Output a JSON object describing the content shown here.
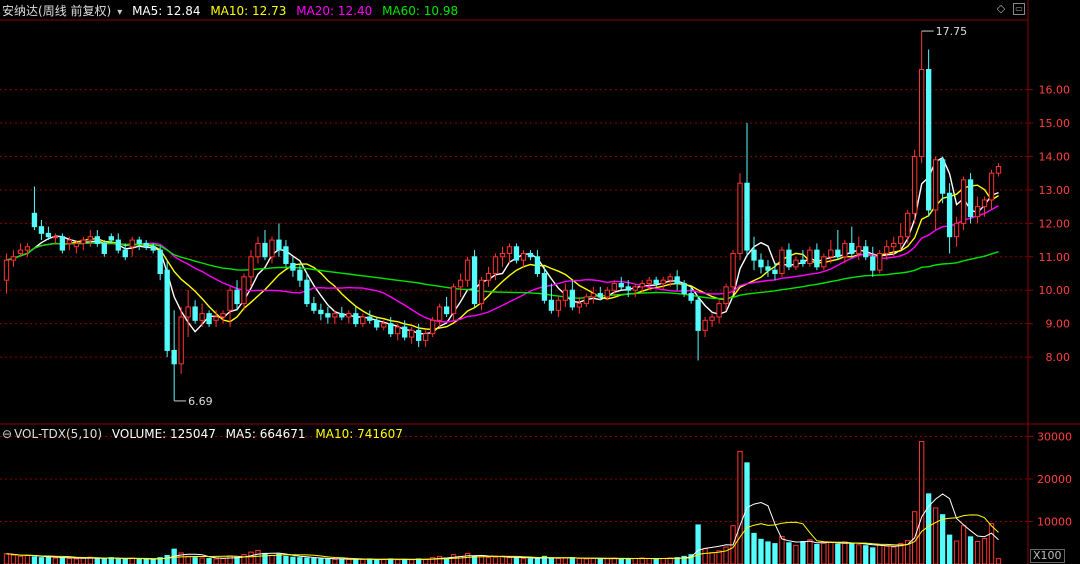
{
  "price_panel": {
    "stock_name": "安纳达",
    "period": "(周线 前复权)",
    "ma5_label": "MA5: 12.84",
    "ma10_label": "MA10: 12.73",
    "ma20_label": "MA20: 12.40",
    "ma60_label": "MA60: 10.98",
    "high_label": "17.75",
    "low_label": "6.69"
  },
  "volume_panel": {
    "indicator_label": "VOL-TDX(5,10)",
    "volume_label": "VOLUME: 125047",
    "ma5_label": "MA5: 664671",
    "ma10_label": "MA10: 741607",
    "unit_label": "X100"
  },
  "colors": {
    "up": "#ff3232",
    "down": "#54fcfc",
    "ma5": "#ffffff",
    "ma10": "#ffff00",
    "ma20": "#ff00ff",
    "ma60": "#00e600",
    "grid": "#8b0000",
    "axis_text": "#ff4040"
  },
  "chart_data": [
    {
      "type": "candlestick",
      "title": "安纳达(周线 前复权)",
      "y_ticks": [
        "8.00",
        "9.00",
        "10.00",
        "11.00",
        "12.00",
        "13.00",
        "14.00",
        "15.00",
        "16.00"
      ],
      "ylim": [
        6.0,
        18.2
      ],
      "grid": true,
      "annotations": [
        {
          "text": "17.75",
          "value": 17.75
        },
        {
          "text": "6.69",
          "value": 6.69
        }
      ],
      "ohlc": [
        [
          10.3,
          11.1,
          9.9,
          10.9
        ],
        [
          10.9,
          11.2,
          10.7,
          11.0
        ],
        [
          11.1,
          11.4,
          11.0,
          11.2
        ],
        [
          11.2,
          11.4,
          11.0,
          11.3
        ],
        [
          12.3,
          13.1,
          11.8,
          11.9
        ],
        [
          11.9,
          12.1,
          11.5,
          11.7
        ],
        [
          11.7,
          11.9,
          11.5,
          11.6
        ],
        [
          11.6,
          11.7,
          11.4,
          11.6
        ],
        [
          11.6,
          11.7,
          11.1,
          11.2
        ],
        [
          11.4,
          11.6,
          11.2,
          11.5
        ],
        [
          11.3,
          11.5,
          11.1,
          11.4
        ],
        [
          11.4,
          11.6,
          11.2,
          11.5
        ],
        [
          11.5,
          11.8,
          11.3,
          11.6
        ],
        [
          11.6,
          11.8,
          11.3,
          11.4
        ],
        [
          11.4,
          11.5,
          11.0,
          11.1
        ],
        [
          11.6,
          11.7,
          11.4,
          11.5
        ],
        [
          11.5,
          11.7,
          11.1,
          11.2
        ],
        [
          11.2,
          11.4,
          10.9,
          11.0
        ],
        [
          11.3,
          11.6,
          11.0,
          11.5
        ],
        [
          11.5,
          11.6,
          11.2,
          11.4
        ],
        [
          11.4,
          11.5,
          11.2,
          11.3
        ],
        [
          11.3,
          11.4,
          11.1,
          11.2
        ],
        [
          11.2,
          11.3,
          10.3,
          10.5
        ],
        [
          10.6,
          10.9,
          8.0,
          8.2
        ],
        [
          8.2,
          9.4,
          6.69,
          7.8
        ],
        [
          7.8,
          9.5,
          7.5,
          9.2
        ],
        [
          9.2,
          10.0,
          8.6,
          9.5
        ],
        [
          9.5,
          9.7,
          9.0,
          9.1
        ],
        [
          9.1,
          9.6,
          8.9,
          9.3
        ],
        [
          9.3,
          9.4,
          8.9,
          9.0
        ],
        [
          9.1,
          9.4,
          8.9,
          9.2
        ],
        [
          9.2,
          9.4,
          9.0,
          9.3
        ],
        [
          9.4,
          10.1,
          8.9,
          10.0
        ],
        [
          10.0,
          10.3,
          9.4,
          9.6
        ],
        [
          9.6,
          10.5,
          9.4,
          10.4
        ],
        [
          10.4,
          11.2,
          10.1,
          11.0
        ],
        [
          11.0,
          11.6,
          10.8,
          11.4
        ],
        [
          11.4,
          11.8,
          10.9,
          11.0
        ],
        [
          11.0,
          11.6,
          10.8,
          11.5
        ],
        [
          11.5,
          12.0,
          11.0,
          11.2
        ],
        [
          11.3,
          11.5,
          10.7,
          10.8
        ],
        [
          10.8,
          11.0,
          10.4,
          10.6
        ],
        [
          10.6,
          10.8,
          10.1,
          10.3
        ],
        [
          10.3,
          10.5,
          9.5,
          9.6
        ],
        [
          9.6,
          9.8,
          9.3,
          9.4
        ],
        [
          9.4,
          9.6,
          9.1,
          9.3
        ],
        [
          9.3,
          9.5,
          9.0,
          9.2
        ],
        [
          9.2,
          9.4,
          9.0,
          9.3
        ],
        [
          9.3,
          9.5,
          9.1,
          9.2
        ],
        [
          9.2,
          9.4,
          9.0,
          9.3
        ],
        [
          9.3,
          9.5,
          8.9,
          9.0
        ],
        [
          9.0,
          9.3,
          8.9,
          9.2
        ],
        [
          9.2,
          9.4,
          9.0,
          9.1
        ],
        [
          9.1,
          9.2,
          8.8,
          8.9
        ],
        [
          8.9,
          9.1,
          8.8,
          9.0
        ],
        [
          9.0,
          9.2,
          8.6,
          8.7
        ],
        [
          8.7,
          9.0,
          8.5,
          8.9
        ],
        [
          8.9,
          9.1,
          8.5,
          8.6
        ],
        [
          8.6,
          8.9,
          8.4,
          8.8
        ],
        [
          8.8,
          9.0,
          8.3,
          8.5
        ],
        [
          8.5,
          8.8,
          8.3,
          8.7
        ],
        [
          8.7,
          9.2,
          8.6,
          9.1
        ],
        [
          9.1,
          9.6,
          8.9,
          9.5
        ],
        [
          9.5,
          9.8,
          9.2,
          9.3
        ],
        [
          9.3,
          10.2,
          9.1,
          10.1
        ],
        [
          10.1,
          10.5,
          9.8,
          10.3
        ],
        [
          10.3,
          11.0,
          10.1,
          10.9
        ],
        [
          11.0,
          11.2,
          9.5,
          9.6
        ],
        [
          9.6,
          10.4,
          9.4,
          10.3
        ],
        [
          10.3,
          10.7,
          10.1,
          10.5
        ],
        [
          10.5,
          11.1,
          10.3,
          11.0
        ],
        [
          11.0,
          11.3,
          10.7,
          11.1
        ],
        [
          11.1,
          11.4,
          10.8,
          11.3
        ],
        [
          11.3,
          11.4,
          10.8,
          10.9
        ],
        [
          10.9,
          11.2,
          10.7,
          11.1
        ],
        [
          11.1,
          11.2,
          10.9,
          11.0
        ],
        [
          11.0,
          11.2,
          10.4,
          10.5
        ],
        [
          10.5,
          10.7,
          9.6,
          9.7
        ],
        [
          9.7,
          10.2,
          9.3,
          9.4
        ],
        [
          9.4,
          9.8,
          9.2,
          9.7
        ],
        [
          9.7,
          10.2,
          9.5,
          10.0
        ],
        [
          10.0,
          10.3,
          9.4,
          9.5
        ],
        [
          9.5,
          9.8,
          9.3,
          9.6
        ],
        [
          9.6,
          9.9,
          9.5,
          9.8
        ],
        [
          9.8,
          10.1,
          9.6,
          9.9
        ],
        [
          9.9,
          10.1,
          9.7,
          9.8
        ],
        [
          9.8,
          10.1,
          9.7,
          10.0
        ],
        [
          10.0,
          10.3,
          9.8,
          10.2
        ],
        [
          10.2,
          10.4,
          10.0,
          10.1
        ],
        [
          10.1,
          10.3,
          9.8,
          10.0
        ],
        [
          10.0,
          10.2,
          9.8,
          10.1
        ],
        [
          10.1,
          10.3,
          9.9,
          10.2
        ],
        [
          10.2,
          10.4,
          10.0,
          10.3
        ],
        [
          10.3,
          10.4,
          10.1,
          10.2
        ],
        [
          10.2,
          10.4,
          10.0,
          10.3
        ],
        [
          10.3,
          10.5,
          10.1,
          10.4
        ],
        [
          10.4,
          10.6,
          10.0,
          10.2
        ],
        [
          10.2,
          10.3,
          9.8,
          9.9
        ],
        [
          9.9,
          10.1,
          9.6,
          9.7
        ],
        [
          9.7,
          9.8,
          7.9,
          8.8
        ],
        [
          8.8,
          9.2,
          8.6,
          9.1
        ],
        [
          9.1,
          9.3,
          8.9,
          9.2
        ],
        [
          9.2,
          9.7,
          9.0,
          9.6
        ],
        [
          9.6,
          10.2,
          9.4,
          10.1
        ],
        [
          10.1,
          11.2,
          9.9,
          11.1
        ],
        [
          11.1,
          13.5,
          10.9,
          13.2
        ],
        [
          13.2,
          15.0,
          11.0,
          11.2
        ],
        [
          11.2,
          11.6,
          10.6,
          10.9
        ],
        [
          10.9,
          11.1,
          10.5,
          10.7
        ],
        [
          10.7,
          10.9,
          10.4,
          10.6
        ],
        [
          10.6,
          10.8,
          10.3,
          10.5
        ],
        [
          10.5,
          11.3,
          10.4,
          11.2
        ],
        [
          11.2,
          11.4,
          10.6,
          10.7
        ],
        [
          10.7,
          11.0,
          10.6,
          10.9
        ],
        [
          10.9,
          11.2,
          10.7,
          10.8
        ],
        [
          10.8,
          11.3,
          10.7,
          11.2
        ],
        [
          11.2,
          11.4,
          10.6,
          10.7
        ],
        [
          10.7,
          11.1,
          10.6,
          11.0
        ],
        [
          11.0,
          11.5,
          10.8,
          11.2
        ],
        [
          11.2,
          11.8,
          10.9,
          11.0
        ],
        [
          11.0,
          11.5,
          10.8,
          11.4
        ],
        [
          11.4,
          11.9,
          11.0,
          11.1
        ],
        [
          11.1,
          11.6,
          10.9,
          11.3
        ],
        [
          11.3,
          11.5,
          10.9,
          11.0
        ],
        [
          11.0,
          11.3,
          10.4,
          10.6
        ],
        [
          10.6,
          11.2,
          10.5,
          11.1
        ],
        [
          11.1,
          11.5,
          10.9,
          11.3
        ],
        [
          11.3,
          11.6,
          11.0,
          11.4
        ],
        [
          11.4,
          12.0,
          11.2,
          11.6
        ],
        [
          11.6,
          12.4,
          11.4,
          12.3
        ],
        [
          12.3,
          14.2,
          12.0,
          14.0
        ],
        [
          14.0,
          17.75,
          13.8,
          16.6
        ],
        [
          16.6,
          17.2,
          12.2,
          12.4
        ],
        [
          12.4,
          14.0,
          11.8,
          13.9
        ],
        [
          13.9,
          14.0,
          12.6,
          12.9
        ],
        [
          12.9,
          13.2,
          11.1,
          11.6
        ],
        [
          11.6,
          12.2,
          11.3,
          12.0
        ],
        [
          12.0,
          13.4,
          11.8,
          13.3
        ],
        [
          13.3,
          13.5,
          12.0,
          12.2
        ],
        [
          12.2,
          12.8,
          12.0,
          12.5
        ],
        [
          12.5,
          12.8,
          12.2,
          12.7
        ],
        [
          12.7,
          13.6,
          12.4,
          13.5
        ],
        [
          13.5,
          13.8,
          13.4,
          13.7
        ]
      ]
    },
    {
      "type": "bar",
      "title": "VOL-TDX(5,10)",
      "y_ticks": [
        "10000",
        "20000",
        "30000"
      ],
      "ylim": [
        0,
        32000
      ],
      "unit": "X100",
      "values": [
        2400,
        2100,
        1800,
        2000,
        1700,
        1500,
        1600,
        1400,
        1500,
        1300,
        1200,
        1400,
        1600,
        1300,
        1200,
        1500,
        1300,
        1100,
        1400,
        1200,
        1100,
        1000,
        1500,
        2000,
        3500,
        2600,
        1800,
        1500,
        1400,
        1300,
        1200,
        1300,
        1900,
        1600,
        2200,
        2800,
        3200,
        2500,
        2000,
        2300,
        1800,
        1600,
        1500,
        1400,
        1300,
        1200,
        1200,
        1100,
        1200,
        1100,
        1000,
        1100,
        1200,
        1000,
        1100,
        1200,
        1000,
        1100,
        1000,
        1200,
        1100,
        1500,
        1800,
        1400,
        2200,
        1800,
        2500,
        1900,
        1700,
        1500,
        1600,
        1800,
        1500,
        1400,
        1300,
        1200,
        1500,
        1800,
        1400,
        1300,
        1400,
        1500,
        1300,
        1200,
        1300,
        1200,
        1300,
        1400,
        1300,
        1200,
        1300,
        1400,
        1300,
        1200,
        1300,
        1400,
        1500,
        1800,
        2200,
        9200,
        3600,
        2700,
        3100,
        4000,
        9000,
        26500,
        23800,
        7200,
        5800,
        5200,
        4800,
        6500,
        5000,
        4400,
        5300,
        5700,
        4600,
        4900,
        5100,
        4700,
        5200,
        4800,
        4500,
        4300,
        3800,
        4600,
        4200,
        4000,
        4800,
        5500,
        12300,
        28800,
        16500,
        13200,
        11600,
        6800,
        5400,
        9000,
        6400,
        5300,
        6000,
        9500,
        1250
      ]
    }
  ]
}
